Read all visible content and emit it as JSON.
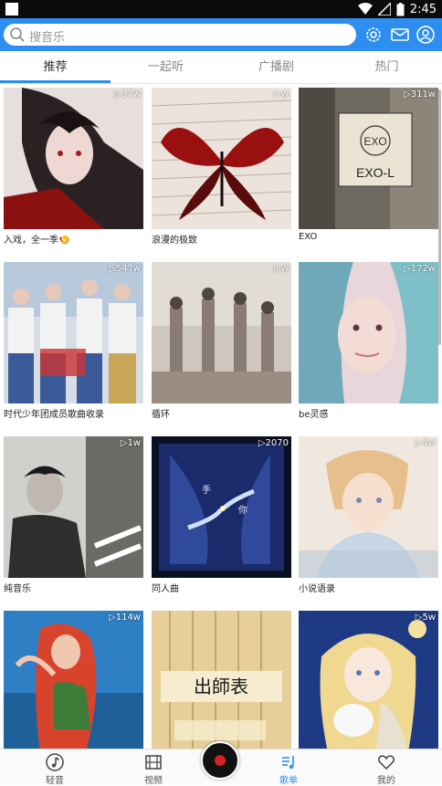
{
  "status_bar": {
    "time": "2:45"
  },
  "search": {
    "placeholder": "搜音乐"
  },
  "tabs": [
    {
      "label": "推荐"
    },
    {
      "label": "一起听"
    },
    {
      "label": "广播剧"
    },
    {
      "label": "热门"
    }
  ],
  "playlists": [
    {
      "title": "入戏，全一季🍤",
      "plays": "▷37w",
      "colors": [
        "#7a1c1c",
        "#d8d0d0"
      ]
    },
    {
      "title": "浪漫的极致",
      "plays": "▷w",
      "colors": [
        "#a52a2a",
        "#e8e0d8"
      ]
    },
    {
      "title": "EXO",
      "plays": "▷311w",
      "colors": [
        "#8a8478",
        "#e9e3d5"
      ]
    },
    {
      "title": "时代少年团成员歌曲收录",
      "plays": "▷547w",
      "colors": [
        "#4a6fb0",
        "#f0f0f0"
      ]
    },
    {
      "title": "循环",
      "plays": "▷w",
      "colors": [
        "#7e7066",
        "#d7cfc8"
      ]
    },
    {
      "title": "be灵感",
      "plays": "▷172w",
      "colors": [
        "#7fb7c7",
        "#f2d8dc"
      ]
    },
    {
      "title": "纯音乐",
      "plays": "▷1w",
      "colors": [
        "#3a3a3a",
        "#c8c8c8"
      ]
    },
    {
      "title": "同人曲",
      "plays": "▷2070",
      "colors": [
        "#0e1740",
        "#6d8ad8"
      ]
    },
    {
      "title": "小说语录",
      "plays": "▷4w",
      "colors": [
        "#e6c7a8",
        "#b9c8d6"
      ]
    },
    {
      "title": "",
      "plays": "▷114w",
      "colors": [
        "#3a8fd0",
        "#d84a34"
      ]
    },
    {
      "title": "",
      "plays": "",
      "colors": [
        "#d7b370",
        "#f0dfa8"
      ]
    },
    {
      "title": "",
      "plays": "▷5w",
      "colors": [
        "#2b4aa0",
        "#f2e8c8"
      ]
    }
  ],
  "cover_text": {
    "exo_sign": "EXO-L",
    "poem": "出師表"
  },
  "bottom_nav": [
    {
      "label": "轻音"
    },
    {
      "label": "视频"
    },
    {
      "label": "歌单"
    },
    {
      "label": "我的"
    }
  ],
  "accent_color": "#2d8ef0"
}
